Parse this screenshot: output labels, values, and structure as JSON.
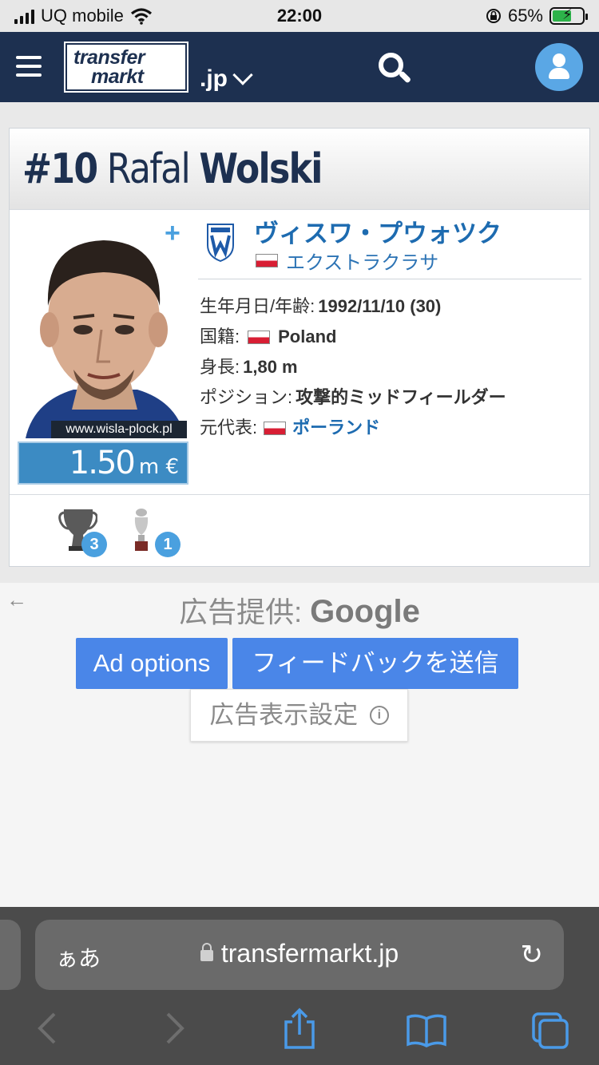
{
  "status_bar": {
    "carrier": "UQ mobile",
    "time": "22:00",
    "battery": "65%"
  },
  "header": {
    "logo_line1": "transfer",
    "logo_line2": "markt",
    "domain": ".jp"
  },
  "player": {
    "number": "#10",
    "first_name": "Rafal",
    "last_name": "Wolski",
    "photo_credit": "www.wisla-plock.pl",
    "market_value": "1.50",
    "market_value_unit": "m €",
    "add_label": "+",
    "club": "ヴィスワ・プウォツク",
    "league": "エクストラクラサ",
    "details": [
      {
        "label": "生年月日/年齢:",
        "value": "1992/11/10 (30)"
      },
      {
        "label": "国籍:",
        "value": "Poland"
      },
      {
        "label": "身長:",
        "value": "1,80 m"
      },
      {
        "label": "ポジション:",
        "value": "攻撃的ミッドフィールダー"
      },
      {
        "label": "元代表:",
        "value": "ポーランド"
      }
    ],
    "trophies": [
      {
        "icon": "cup-trophy-icon",
        "count": "3"
      },
      {
        "icon": "silver-trophy-icon",
        "count": "1"
      }
    ],
    "colors": {
      "navy": "#1d3050",
      "link": "#1d6bb0",
      "accent": "#4aa0df"
    }
  },
  "ad": {
    "back": "←",
    "provider_label": "広告提供:",
    "provider": "Google",
    "ad_options": "Ad options",
    "feedback": "フィードバックを送信",
    "settings": "広告表示設定",
    "info_icon": "i"
  },
  "safari": {
    "text_size": "ぁあ",
    "url": "transfermarkt.jp",
    "reload": "↻"
  }
}
